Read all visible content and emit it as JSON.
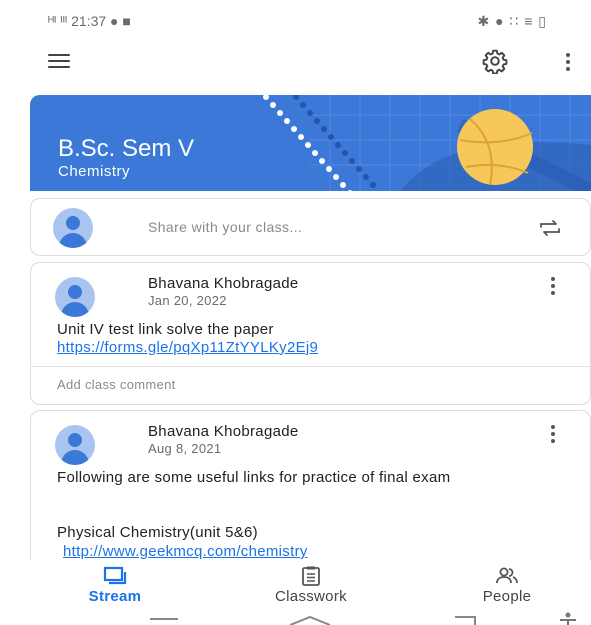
{
  "status_bar": {
    "left": "ᴴᴵ ᴵᴵᴵ 21:37 ● ■",
    "right": "✱ ● ∷ ≡ ▯"
  },
  "app_bar": {
    "menu_icon": "hamburger-icon",
    "settings_icon": "gear-icon",
    "overflow_icon": "kebab-icon"
  },
  "banner": {
    "title": "B.Sc. Sem V",
    "subtitle": "Chemistry",
    "accent": "#3b78d8"
  },
  "share": {
    "placeholder": "Share with your class...",
    "repost_icon": "repost-icon"
  },
  "posts": [
    {
      "author": "Bhavana Khobragade",
      "date": "Jan 20, 2022",
      "text": "Unit IV test link solve the paper",
      "link": "https://forms.gle/pqXp11ZtYYLKy2Ej9",
      "comment_placeholder": "Add class comment"
    },
    {
      "author": "Bhavana Khobragade",
      "date": "Aug 8, 2021",
      "text": "Following are some useful links for practice of final exam",
      "text2": "Physical Chemistry(unit 5&6)",
      "link": "http://www.geekmcq.com/chemistry"
    }
  ],
  "bottom_nav": {
    "tabs": [
      {
        "label": "Stream",
        "icon": "stream-icon",
        "active": true
      },
      {
        "label": "Classwork",
        "icon": "classwork-icon",
        "active": false
      },
      {
        "label": "People",
        "icon": "people-icon",
        "active": false
      }
    ]
  },
  "colors": {
    "link": "#1a73e8",
    "active_tab": "#1a73e8",
    "avatar": "#a9c5ef"
  }
}
